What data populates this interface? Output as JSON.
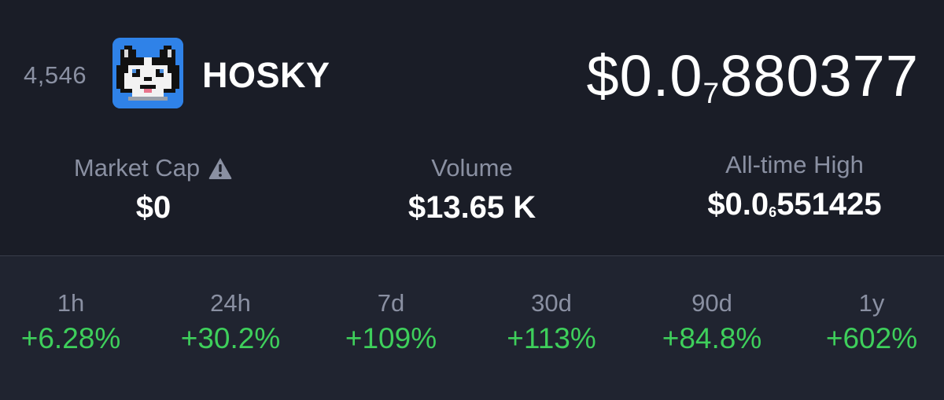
{
  "coin": {
    "rank": "4,546",
    "name": "HOSKY",
    "logo_icon": "husky-dog-logo-icon",
    "price_prefix": "$0.0",
    "price_zero_count": "7",
    "price_digits": "880377"
  },
  "stats": {
    "market_cap": {
      "label": "Market Cap",
      "value": "$0",
      "icon": "warning-triangle-icon"
    },
    "volume": {
      "label": "Volume",
      "value": "$13.65 K"
    },
    "ath": {
      "label": "All-time High",
      "value_prefix": "$0.0",
      "value_zero_count": "6",
      "value_digits": "551425"
    }
  },
  "changes": [
    {
      "period": "1h",
      "value": "+6.28%"
    },
    {
      "period": "24h",
      "value": "+30.2%"
    },
    {
      "period": "7d",
      "value": "+109%"
    },
    {
      "period": "30d",
      "value": "+113%"
    },
    {
      "period": "90d",
      "value": "+84.8%"
    },
    {
      "period": "1y",
      "value": "+602%"
    }
  ],
  "colors": {
    "background": "#1a1d27",
    "changes_background": "#202430",
    "positive": "#3ecf5b",
    "muted_text": "#8a90a2",
    "logo_background": "#2f82e8"
  }
}
